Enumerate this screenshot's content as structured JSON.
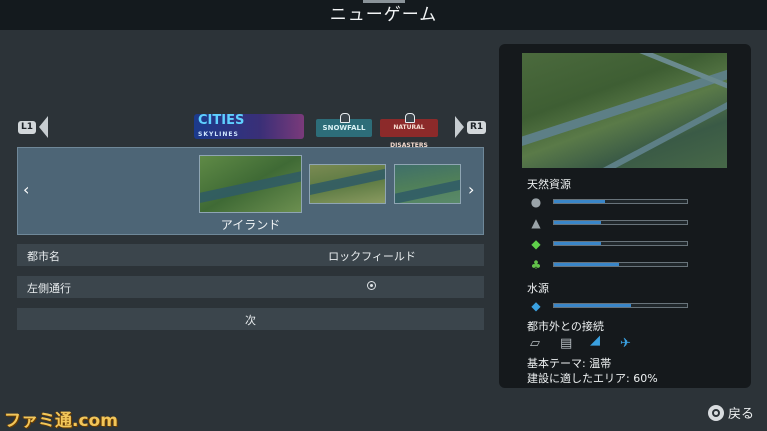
{
  "header": {
    "title": "ニューゲーム"
  },
  "shoulders": {
    "left": "L1",
    "right": "R1"
  },
  "dlc": {
    "cities_title": "CITIES",
    "cities_sub": "SKYLINES",
    "snowfall": "SNOWFALL",
    "natural_disasters": "NATURAL DISASTERS"
  },
  "map_selector": {
    "prev_glyph": "‹",
    "next_glyph": "›",
    "selected_map": "アイランド"
  },
  "form": {
    "city_name_label": "都市名",
    "city_name_value": "ロックフィールド",
    "left_traffic_label": "左側通行",
    "next_label": "次"
  },
  "info_panel": {
    "natural_resources_label": "天然資源",
    "resources": [
      {
        "icon": "oil-icon",
        "level": 0.38
      },
      {
        "icon": "ore-icon",
        "level": 0.35
      },
      {
        "icon": "fertile-land-icon",
        "level": 0.35
      },
      {
        "icon": "forest-icon",
        "level": 0.49
      }
    ],
    "water_label": "水源",
    "water_level": 0.58,
    "outside_connections_label": "都市外との接続",
    "connections": [
      "road-icon",
      "train-icon",
      "ship-icon",
      "airplane-icon"
    ],
    "theme_text": "基本テーマ: 温帯",
    "buildable_text": "建設に適したエリア: 60%"
  },
  "watermark": "ファミ通.com",
  "footer": {
    "back_label": "戻る"
  },
  "colors": {
    "accent": "#3a86c8",
    "selector_bg": "#4d6576",
    "panel_bg": "#15191c"
  }
}
